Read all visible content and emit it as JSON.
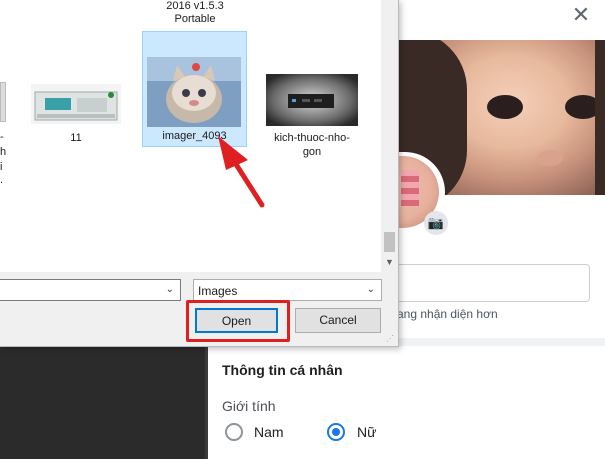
{
  "colors": {
    "accent": "#1877f2",
    "selection": "#cce8ff",
    "annotation": "#e02020"
  },
  "dialog": {
    "top_file_label": [
      "2016 v1.5.3",
      "Portable"
    ],
    "left_partial_labels": [
      "-",
      "h",
      "i",
      "."
    ],
    "files": [
      {
        "name": "11",
        "icon": "printer-image-icon"
      },
      {
        "name": "imager_4093",
        "icon": "cat-photo-icon",
        "selected": true
      },
      {
        "name_lines": [
          "kich-thuoc-nho-",
          "gon"
        ],
        "icon": "mini-pc-photo-icon"
      }
    ],
    "filename_value": "",
    "filter_value": "Images",
    "open_label": "Open",
    "cancel_label": "Cancel"
  },
  "profile": {
    "close_icon": "close-icon",
    "camera_icon": "camera-icon",
    "hint": "ang nhận diện hơn",
    "section_title": "Thông tin cá nhân",
    "gender_label": "Giới tính",
    "gender_options": [
      {
        "label": "Nam",
        "checked": false
      },
      {
        "label": "Nữ",
        "checked": true
      }
    ]
  }
}
